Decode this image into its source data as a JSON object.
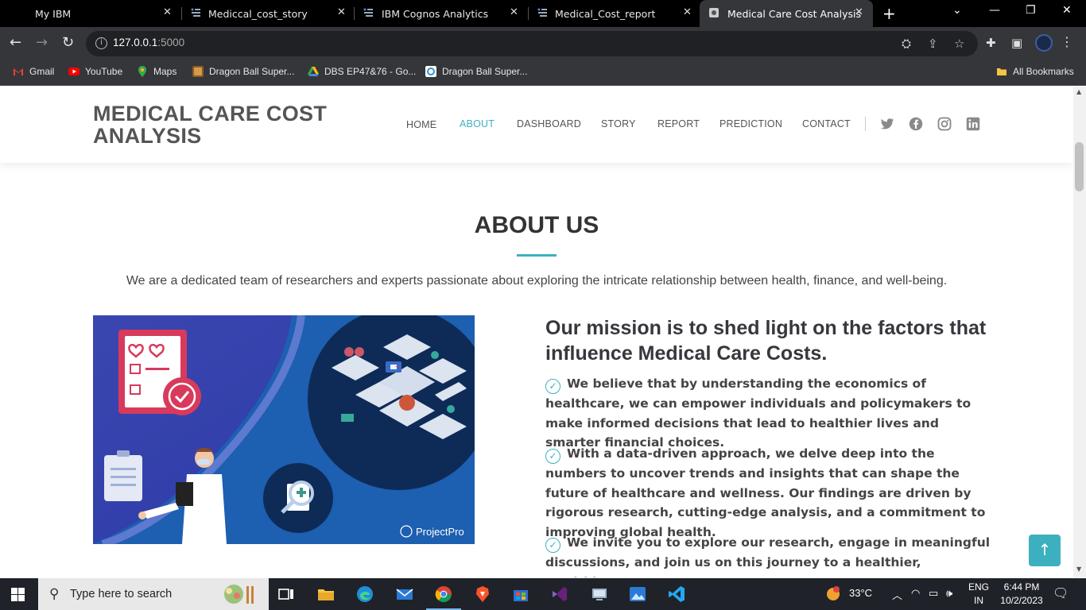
{
  "browser": {
    "tabs": [
      {
        "label": "My IBM"
      },
      {
        "label": "Mediccal_cost_story"
      },
      {
        "label": "IBM Cognos Analytics"
      },
      {
        "label": "Medical_Cost_report"
      },
      {
        "label": "Medical Care Cost Analysis"
      }
    ],
    "url_host": "127.0.0.1",
    "url_port": ":5000",
    "bookmarks": [
      {
        "label": "Gmail",
        "icon": "gmail-icon"
      },
      {
        "label": "YouTube",
        "icon": "youtube-icon"
      },
      {
        "label": "Maps",
        "icon": "maps-icon"
      },
      {
        "label": "Dragon Ball Super...",
        "icon": "bookmark-thumb-icon"
      },
      {
        "label": "DBS EP47&76 - Go...",
        "icon": "drive-icon"
      },
      {
        "label": "Dragon Ball Super...",
        "icon": "bookmark-site-icon"
      }
    ],
    "all_bookmarks": "All Bookmarks"
  },
  "site": {
    "logo": "MEDICAL CARE COST ANALYSIS",
    "nav": [
      "HOME",
      "ABOUT",
      "DASHBOARD",
      "STORY",
      "REPORT",
      "PREDICTION",
      "CONTACT"
    ],
    "active_nav": "ABOUT",
    "accent": "#3db0c0"
  },
  "about": {
    "title": "ABOUT US",
    "lead": "We are a dedicated team of researchers and experts passionate about exploring the intricate relationship between health, finance, and well-being.",
    "image_watermark": "ProjectPro",
    "mission_title": "Our mission is to shed light on the factors that influence Medical Care Costs.",
    "bullets": [
      "We believe that by understanding the economics of healthcare, we can empower individuals and policymakers to make informed decisions that lead to healthier lives and smarter financial choices.",
      "With a data-driven approach, we delve deep into the numbers to uncover trends and insights that can shape the future of healthcare and wellness. Our findings are driven by rigorous research, cutting-edge analysis, and a commitment to improving global health.",
      "We invite you to explore our research, engage in meaningful discussions, and join us on this journey to a healthier, wealthier,"
    ]
  },
  "taskbar": {
    "search_placeholder": "Type here to search",
    "weather": "33°C",
    "lang_top": "ENG",
    "lang_bottom": "IN",
    "time": "6:44 PM",
    "date": "10/2/2023"
  }
}
